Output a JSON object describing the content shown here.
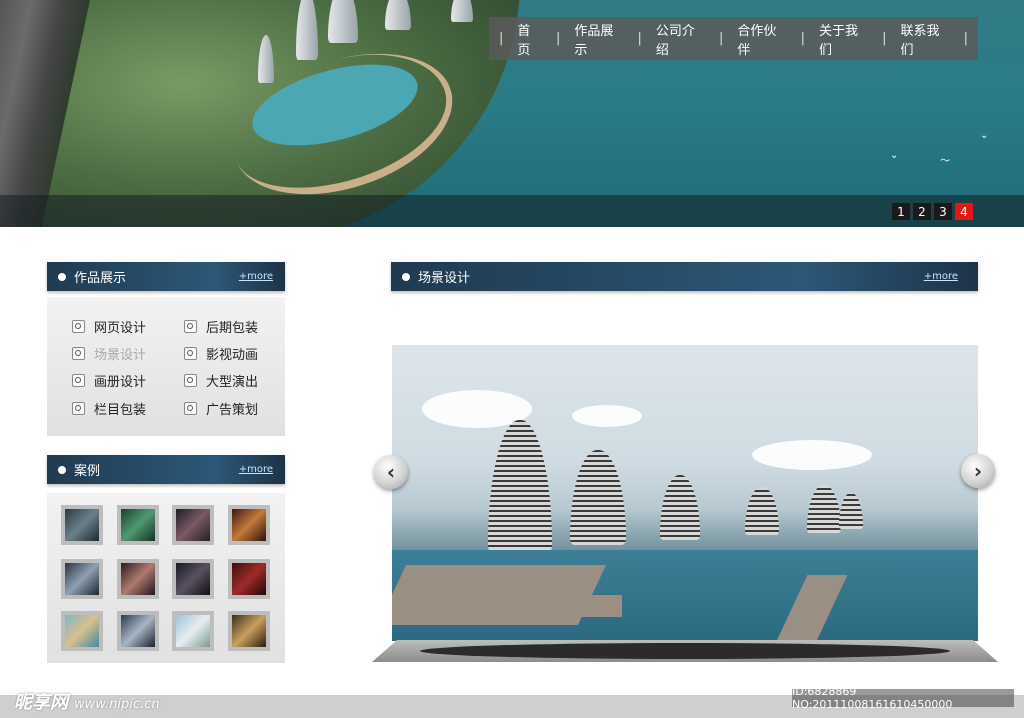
{
  "nav": {
    "items": [
      "首页",
      "作品展示",
      "公司介绍",
      "合作伙伴",
      "关于我们",
      "联系我们"
    ],
    "separator": "|"
  },
  "hero": {
    "pager": [
      "1",
      "2",
      "3",
      "4"
    ],
    "active_page": "4"
  },
  "works_panel": {
    "title": "作品展示",
    "more": "+more",
    "items": [
      "网页设计",
      "后期包装",
      "场景设计",
      "影视动画",
      "画册设计",
      "大型演出",
      "栏目包装",
      "广告策划"
    ],
    "dimmed_item": "场景设计"
  },
  "cases_panel": {
    "title": "案例",
    "more": "+more",
    "thumb_count": 12
  },
  "scene_panel": {
    "title": "场景设计",
    "more": "+more"
  },
  "slider": {
    "prev_icon": "‹",
    "next_icon": "›"
  },
  "watermark": {
    "left": "昵享网",
    "site": "www.nipic.cn",
    "right": "ID:6828869 NO:20111008161610450000"
  },
  "colors": {
    "accent": "#e01818",
    "header": "#2c5778",
    "nav_bg": "#5a5a5a"
  }
}
